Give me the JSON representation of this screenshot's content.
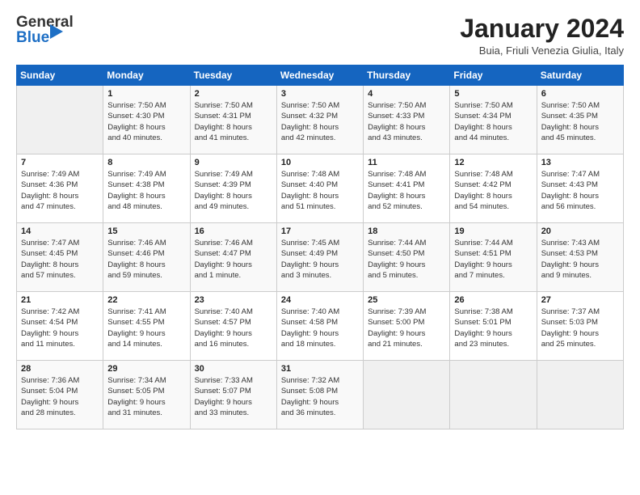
{
  "logo": {
    "line1": "General",
    "line2": "Blue"
  },
  "title": "January 2024",
  "location": "Buia, Friuli Venezia Giulia, Italy",
  "days_header": [
    "Sunday",
    "Monday",
    "Tuesday",
    "Wednesday",
    "Thursday",
    "Friday",
    "Saturday"
  ],
  "weeks": [
    [
      {
        "day": "",
        "info": ""
      },
      {
        "day": "1",
        "info": "Sunrise: 7:50 AM\nSunset: 4:30 PM\nDaylight: 8 hours\nand 40 minutes."
      },
      {
        "day": "2",
        "info": "Sunrise: 7:50 AM\nSunset: 4:31 PM\nDaylight: 8 hours\nand 41 minutes."
      },
      {
        "day": "3",
        "info": "Sunrise: 7:50 AM\nSunset: 4:32 PM\nDaylight: 8 hours\nand 42 minutes."
      },
      {
        "day": "4",
        "info": "Sunrise: 7:50 AM\nSunset: 4:33 PM\nDaylight: 8 hours\nand 43 minutes."
      },
      {
        "day": "5",
        "info": "Sunrise: 7:50 AM\nSunset: 4:34 PM\nDaylight: 8 hours\nand 44 minutes."
      },
      {
        "day": "6",
        "info": "Sunrise: 7:50 AM\nSunset: 4:35 PM\nDaylight: 8 hours\nand 45 minutes."
      }
    ],
    [
      {
        "day": "7",
        "info": "Sunrise: 7:49 AM\nSunset: 4:36 PM\nDaylight: 8 hours\nand 47 minutes."
      },
      {
        "day": "8",
        "info": "Sunrise: 7:49 AM\nSunset: 4:38 PM\nDaylight: 8 hours\nand 48 minutes."
      },
      {
        "day": "9",
        "info": "Sunrise: 7:49 AM\nSunset: 4:39 PM\nDaylight: 8 hours\nand 49 minutes."
      },
      {
        "day": "10",
        "info": "Sunrise: 7:48 AM\nSunset: 4:40 PM\nDaylight: 8 hours\nand 51 minutes."
      },
      {
        "day": "11",
        "info": "Sunrise: 7:48 AM\nSunset: 4:41 PM\nDaylight: 8 hours\nand 52 minutes."
      },
      {
        "day": "12",
        "info": "Sunrise: 7:48 AM\nSunset: 4:42 PM\nDaylight: 8 hours\nand 54 minutes."
      },
      {
        "day": "13",
        "info": "Sunrise: 7:47 AM\nSunset: 4:43 PM\nDaylight: 8 hours\nand 56 minutes."
      }
    ],
    [
      {
        "day": "14",
        "info": "Sunrise: 7:47 AM\nSunset: 4:45 PM\nDaylight: 8 hours\nand 57 minutes."
      },
      {
        "day": "15",
        "info": "Sunrise: 7:46 AM\nSunset: 4:46 PM\nDaylight: 8 hours\nand 59 minutes."
      },
      {
        "day": "16",
        "info": "Sunrise: 7:46 AM\nSunset: 4:47 PM\nDaylight: 9 hours\nand 1 minute."
      },
      {
        "day": "17",
        "info": "Sunrise: 7:45 AM\nSunset: 4:49 PM\nDaylight: 9 hours\nand 3 minutes."
      },
      {
        "day": "18",
        "info": "Sunrise: 7:44 AM\nSunset: 4:50 PM\nDaylight: 9 hours\nand 5 minutes."
      },
      {
        "day": "19",
        "info": "Sunrise: 7:44 AM\nSunset: 4:51 PM\nDaylight: 9 hours\nand 7 minutes."
      },
      {
        "day": "20",
        "info": "Sunrise: 7:43 AM\nSunset: 4:53 PM\nDaylight: 9 hours\nand 9 minutes."
      }
    ],
    [
      {
        "day": "21",
        "info": "Sunrise: 7:42 AM\nSunset: 4:54 PM\nDaylight: 9 hours\nand 11 minutes."
      },
      {
        "day": "22",
        "info": "Sunrise: 7:41 AM\nSunset: 4:55 PM\nDaylight: 9 hours\nand 14 minutes."
      },
      {
        "day": "23",
        "info": "Sunrise: 7:40 AM\nSunset: 4:57 PM\nDaylight: 9 hours\nand 16 minutes."
      },
      {
        "day": "24",
        "info": "Sunrise: 7:40 AM\nSunset: 4:58 PM\nDaylight: 9 hours\nand 18 minutes."
      },
      {
        "day": "25",
        "info": "Sunrise: 7:39 AM\nSunset: 5:00 PM\nDaylight: 9 hours\nand 21 minutes."
      },
      {
        "day": "26",
        "info": "Sunrise: 7:38 AM\nSunset: 5:01 PM\nDaylight: 9 hours\nand 23 minutes."
      },
      {
        "day": "27",
        "info": "Sunrise: 7:37 AM\nSunset: 5:03 PM\nDaylight: 9 hours\nand 25 minutes."
      }
    ],
    [
      {
        "day": "28",
        "info": "Sunrise: 7:36 AM\nSunset: 5:04 PM\nDaylight: 9 hours\nand 28 minutes."
      },
      {
        "day": "29",
        "info": "Sunrise: 7:34 AM\nSunset: 5:05 PM\nDaylight: 9 hours\nand 31 minutes."
      },
      {
        "day": "30",
        "info": "Sunrise: 7:33 AM\nSunset: 5:07 PM\nDaylight: 9 hours\nand 33 minutes."
      },
      {
        "day": "31",
        "info": "Sunrise: 7:32 AM\nSunset: 5:08 PM\nDaylight: 9 hours\nand 36 minutes."
      },
      {
        "day": "",
        "info": ""
      },
      {
        "day": "",
        "info": ""
      },
      {
        "day": "",
        "info": ""
      }
    ]
  ]
}
